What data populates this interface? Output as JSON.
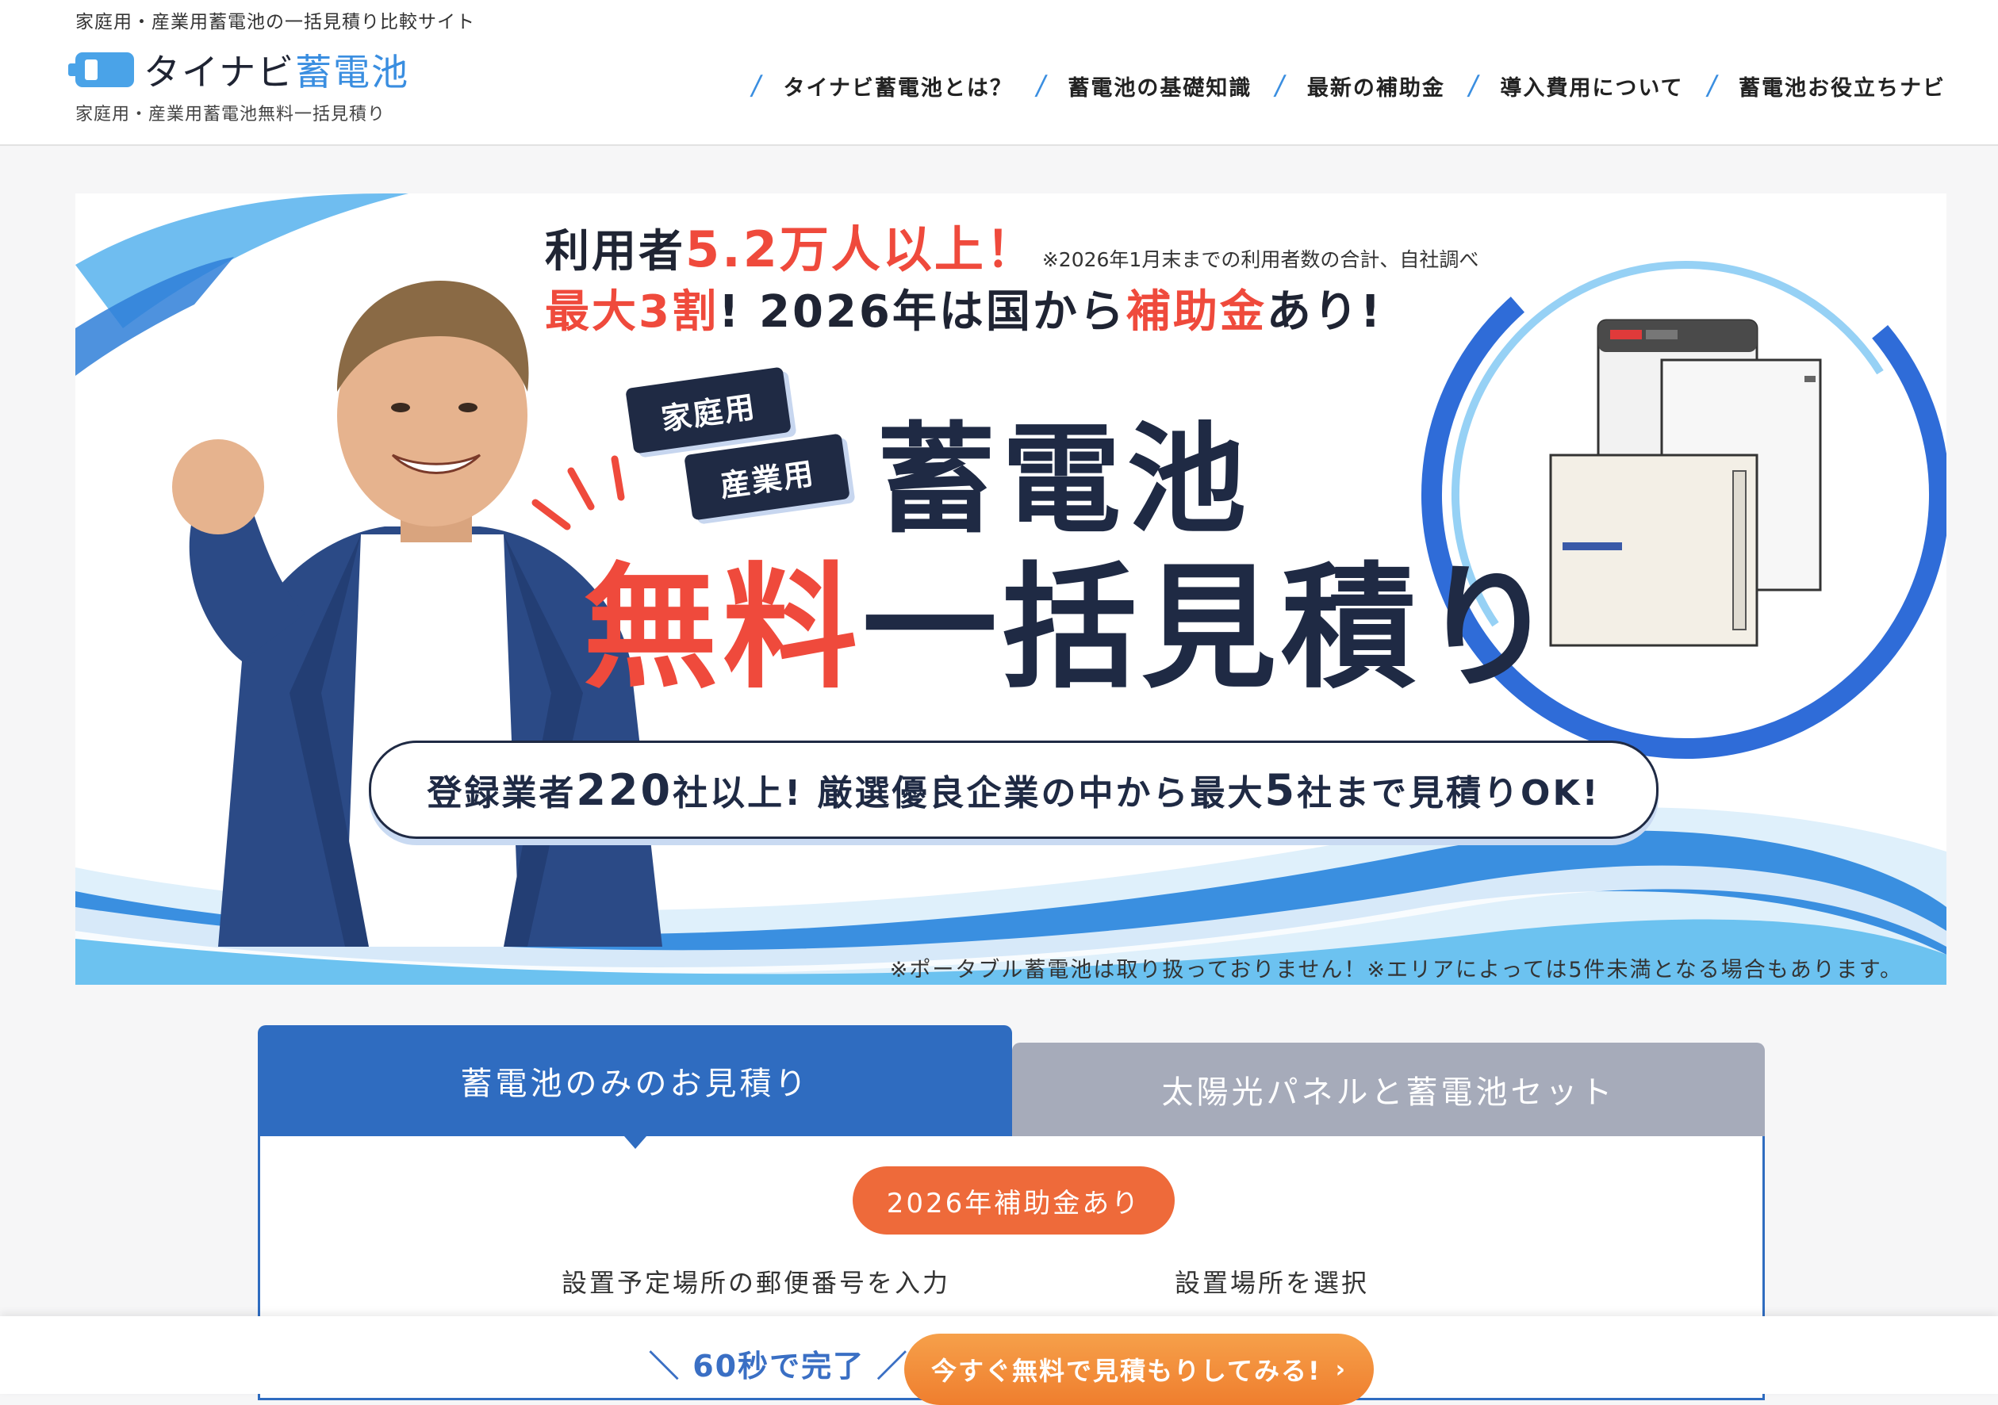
{
  "header": {
    "tagline": "家庭用・産業用蓄電池の一括見積り比較サイト",
    "logo_main": "タイナビ",
    "logo_accent": "蓄電池",
    "logo_sub": "家庭用・産業用蓄電池無料一括見積り",
    "nav": [
      {
        "label": "タイナビ蓄電池とは？"
      },
      {
        "label": "蓄電池の基礎知識"
      },
      {
        "label": "最新の補助金"
      },
      {
        "label": "導入費用について"
      },
      {
        "label": "蓄電池お役立ちナビ"
      }
    ]
  },
  "hero": {
    "users_prefix": "利用者",
    "users_value": "5.2万人以上！",
    "users_note": "※2026年1月末までの利用者数の合計、自社調べ",
    "subsidy_prefix": "最大",
    "subsidy_value": "3割",
    "subsidy_mid": "! 2026年は国から",
    "subsidy_word": "補助金",
    "subsidy_suffix": "あり!",
    "pill_home": "家庭用",
    "pill_industrial": "産業用",
    "title": "蓄電池",
    "main_red": "無料",
    "main_rest": "一括見積り",
    "banner_a": "登録業者",
    "banner_num1": "220",
    "banner_b": "社以上! 厳選優良企業の中から最大",
    "banner_num2": "5",
    "banner_c": "社まで見積りOK!",
    "footnote": "※ポータブル蓄電池は取り扱っておりません！※エリアによっては5件未満となる場合もあります。"
  },
  "panel": {
    "tab_active": "蓄電池のみのお見積り",
    "tab_inactive": "太陽光パネルと蓄電池セット",
    "badge": "2026年補助金あり",
    "label_zip": "設置予定場所の郵便番号を入力",
    "label_place": "設置場所を選択"
  },
  "sticky": {
    "note": "＼ 60秒で完了 ／",
    "button": "今すぐ無料で見積もりしてみる!",
    "chevron": "›"
  },
  "colors": {
    "accent_blue": "#2f6cc0",
    "logo_blue": "#3a8ee0",
    "red": "#ef4a3c",
    "orange": "#ee6a3a",
    "navy": "#1f2a44",
    "inactive_tab": "#a6abba"
  }
}
